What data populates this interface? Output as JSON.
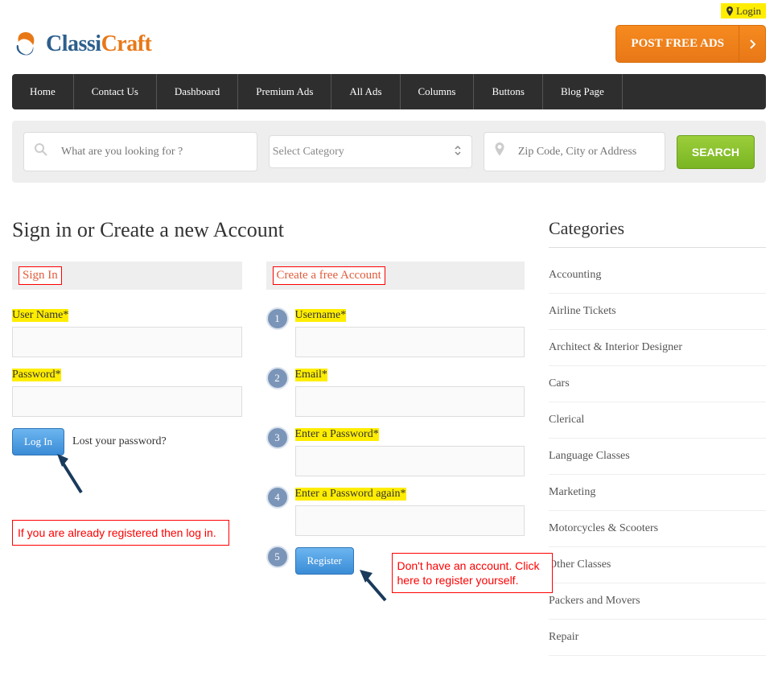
{
  "header": {
    "login_label": "Login",
    "logo_text_1": "Classi",
    "logo_text_2": "Craft",
    "post_ads_label": "POST FREE ADS"
  },
  "nav": {
    "items": [
      "Home",
      "Contact Us",
      "Dashboard",
      "Premium Ads",
      "All Ads",
      "Columns",
      "Buttons",
      "Blog Page"
    ]
  },
  "search": {
    "keyword_placeholder": "What are you looking for ?",
    "category_placeholder": "Select Category",
    "location_placeholder": "Zip Code, City or Address",
    "search_button": "SEARCH"
  },
  "page": {
    "title": "Sign in or Create a new Account"
  },
  "signin": {
    "heading": "Sign In",
    "username_label": "User Name*",
    "password_label": "Password*",
    "login_button": "Log In",
    "lost_password": "Lost your password?"
  },
  "signup": {
    "heading": "Create a free Account",
    "username_label": "Username*",
    "email_label": "Email*",
    "password_label": "Enter a Password*",
    "password2_label": "Enter a Password again*",
    "register_button": "Register"
  },
  "annotations": {
    "login_note": "If you are already registered then log in.",
    "register_note": "Don't have an account. Click here to register yourself."
  },
  "sidebar": {
    "title": "Categories",
    "items": [
      "Accounting",
      "Airline Tickets",
      "Architect & Interior Designer",
      "Cars",
      "Clerical",
      "Language Classes",
      "Marketing",
      "Motorcycles & Scooters",
      "Other Classes",
      "Packers and Movers",
      "Repair"
    ]
  }
}
